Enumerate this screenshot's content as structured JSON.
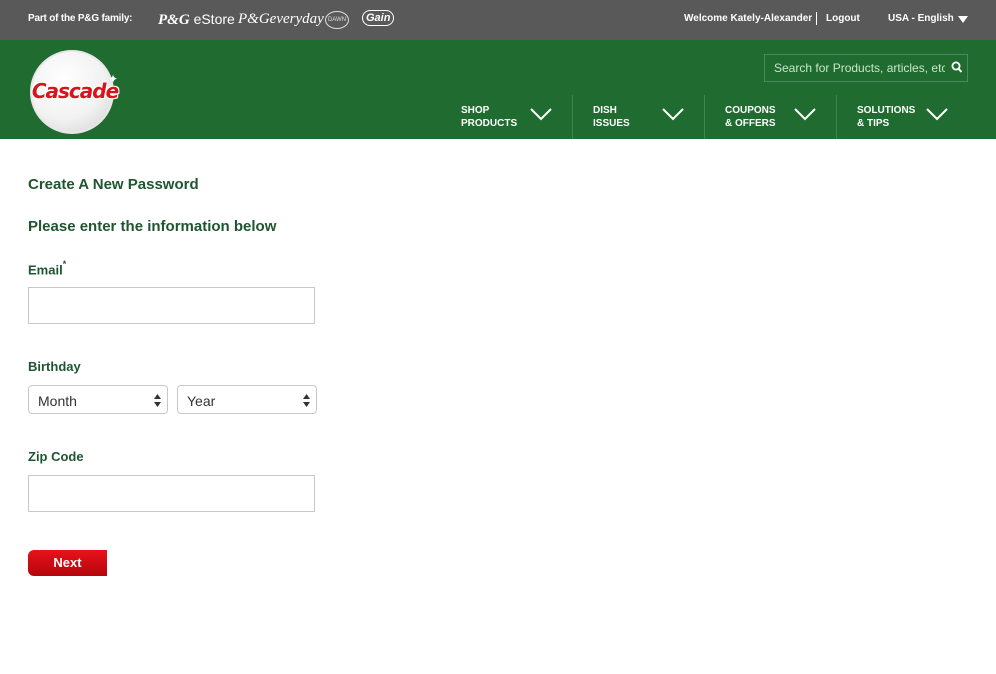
{
  "topbar": {
    "family_label": "Part of the P&G family:",
    "brands": {
      "estore_pg": "P&G",
      "estore_text": "eStore",
      "everyday": "P&Geveryday",
      "dawn": "DAWN",
      "gain": "Gain"
    },
    "welcome": "Welcome Kately-Alexander",
    "logout": "Logout",
    "locale": "USA - English"
  },
  "header": {
    "logo_text": "Cascade",
    "search_placeholder": "Search for Products, articles, etc",
    "nav": [
      {
        "line1": "SHOP",
        "line2": "PRODUCTS"
      },
      {
        "line1": "DISH",
        "line2": "ISSUES"
      },
      {
        "line1": "COUPONS",
        "line2": "& OFFERS"
      },
      {
        "line1": "SOLUTIONS",
        "line2": "& TIPS"
      }
    ]
  },
  "form": {
    "title": "Create A New Password",
    "subtitle": "Please enter the information below",
    "email_label": "Email",
    "required_mark": "*",
    "email_value": "",
    "birthday_label": "Birthday",
    "month_selected": "Month",
    "year_selected": "Year",
    "zip_label": "Zip Code",
    "zip_value": "",
    "next_label": "Next"
  },
  "colors": {
    "topbar_bg": "#595959",
    "header_green": "#1f6b30",
    "label_green": "#1f5530",
    "button_red": "#d7141b"
  }
}
